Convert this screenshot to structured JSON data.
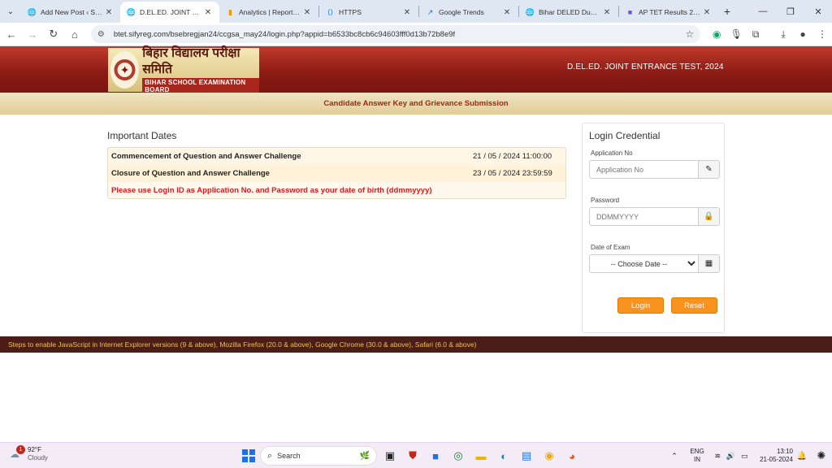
{
  "browser": {
    "tabs": [
      {
        "title": "Add New Post ‹ Sarkari",
        "favicon": "globe-icon",
        "active": false
      },
      {
        "title": "D.EL.ED. JOINT ENTRANCE",
        "favicon": "globe-icon",
        "active": true
      },
      {
        "title": "Analytics | Reports snapshot",
        "favicon": "analytics-icon",
        "active": false
      },
      {
        "title": "HTTPS",
        "favicon": "https-icon",
        "active": false
      },
      {
        "title": "Google Trends",
        "favicon": "trends-icon",
        "active": false
      },
      {
        "title": "Bihar DELED Dummy",
        "favicon": "globe-icon",
        "active": false
      },
      {
        "title": "AP TET Results 2024",
        "favicon": "bookmark-icon",
        "active": false
      }
    ],
    "url": "btet.sifyreg.com/bsebregjan24/ccgsa_may24/login.php?appid=b6533bc8cb6c94603fff0d13b72b8e9f"
  },
  "header": {
    "logo_hindi": "बिहार विद्यालय परीक्षा समिति",
    "logo_english": "BIHAR SCHOOL EXAMINATION BOARD",
    "title": "D.EL.ED. JOINT ENTRANCE TEST, 2024",
    "subtitle": "Candidate Answer Key and Grievance Submission"
  },
  "important_dates": {
    "heading": "Important Dates",
    "rows": [
      {
        "label": "Commencement of Question and Answer Challenge",
        "value": "21 / 05 / 2024 11:00:00"
      },
      {
        "label": "Closure of Question and Answer Challenge",
        "value": "23 / 05 / 2024 23:59:59"
      }
    ],
    "notice": "Please use Login ID as Application No. and Password as your date of birth (ddmmyyyy)"
  },
  "login": {
    "heading": "Login Credential",
    "application_label": "Application No",
    "application_placeholder": "Application No",
    "password_label": "Password",
    "password_placeholder": "DDMMYYYY",
    "exam_date_label": "Date of Exam",
    "exam_date_selected": "-- Choose Date --",
    "login_button": "Login",
    "reset_button": "Reset"
  },
  "footer": {
    "text": "Steps to enable JavaScript in Internet Explorer versions (9 & above), Mozilla Firefox (20.0 & above), Google Chrome (30.0 & above), Safari (6.0 & above)"
  },
  "taskbar": {
    "weather_temp": "92°F",
    "weather_desc": "Cloudy",
    "weather_badge": "1",
    "search_label": "Search",
    "lang_top": "ENG",
    "lang_bottom": "IN",
    "time": "13:10",
    "date": "21-05-2024"
  },
  "colors": {
    "header_red": "#8a1a14",
    "button_orange": "#f7931e",
    "notice_red": "#e0171d",
    "footer_brown": "#4a1d17"
  }
}
